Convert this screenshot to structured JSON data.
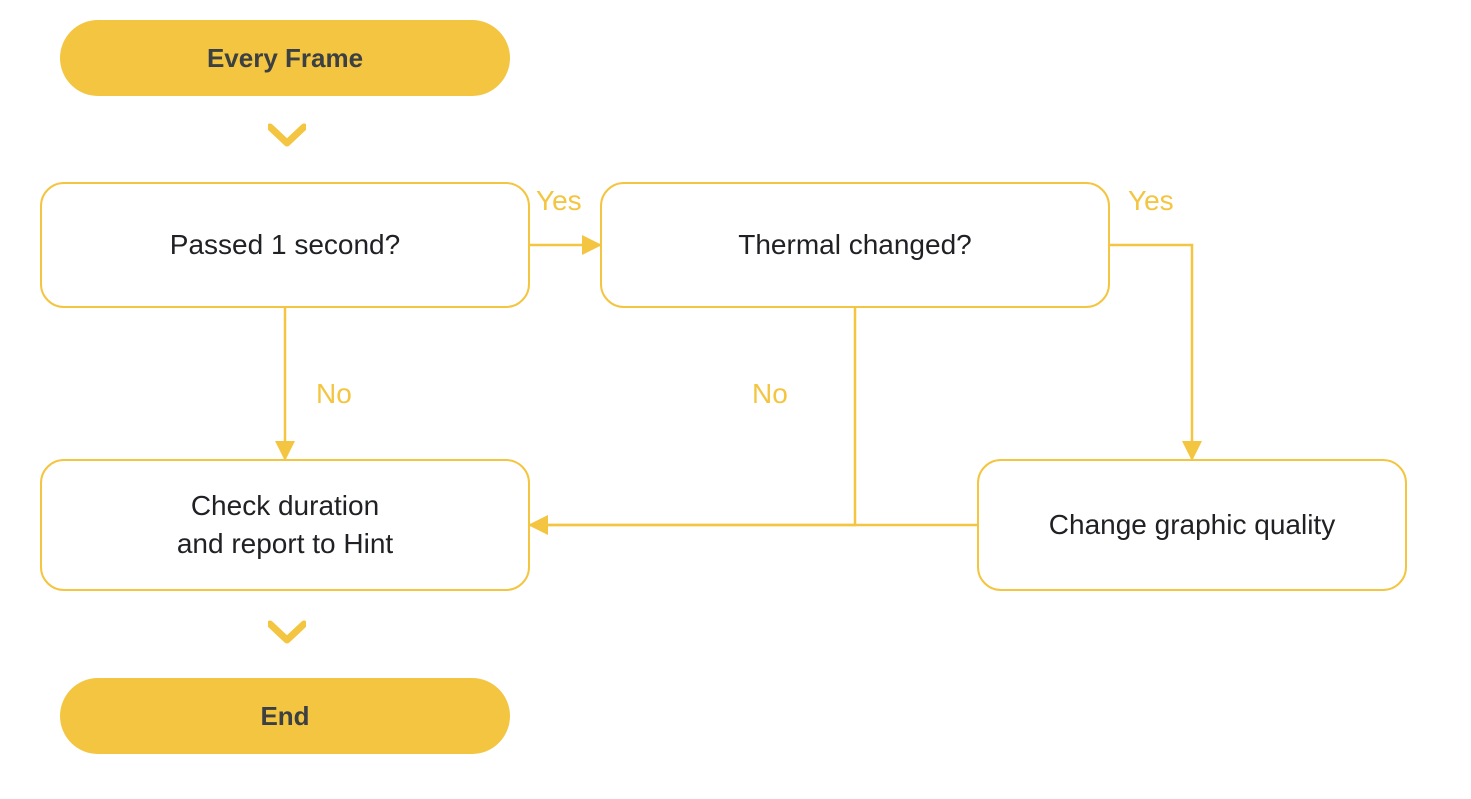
{
  "colors": {
    "accent": "#f3c540",
    "text_dark": "#3c4043",
    "text_body": "#202124",
    "background": "#ffffff"
  },
  "nodes": {
    "start": {
      "label": "Every Frame"
    },
    "decision1": {
      "label": "Passed 1 second?"
    },
    "decision2": {
      "label": "Thermal changed?"
    },
    "process1": {
      "label": "Check duration\nand report to Hint"
    },
    "process2": {
      "label": "Change graphic quality"
    },
    "end": {
      "label": "End"
    }
  },
  "edges": {
    "d1_yes": "Yes",
    "d1_no": "No",
    "d2_yes": "Yes",
    "d2_no": "No"
  },
  "chart_data": {
    "type": "flowchart",
    "nodes": [
      {
        "id": "start",
        "kind": "terminator",
        "label": "Every Frame"
      },
      {
        "id": "decision1",
        "kind": "decision",
        "label": "Passed 1 second?"
      },
      {
        "id": "decision2",
        "kind": "decision",
        "label": "Thermal changed?"
      },
      {
        "id": "process1",
        "kind": "process",
        "label": "Check duration and report to Hint"
      },
      {
        "id": "process2",
        "kind": "process",
        "label": "Change graphic quality"
      },
      {
        "id": "end",
        "kind": "terminator",
        "label": "End"
      }
    ],
    "edges": [
      {
        "from": "start",
        "to": "decision1",
        "label": ""
      },
      {
        "from": "decision1",
        "to": "decision2",
        "label": "Yes"
      },
      {
        "from": "decision1",
        "to": "process1",
        "label": "No"
      },
      {
        "from": "decision2",
        "to": "process2",
        "label": "Yes"
      },
      {
        "from": "decision2",
        "to": "process1",
        "label": "No"
      },
      {
        "from": "process2",
        "to": "process1",
        "label": ""
      },
      {
        "from": "process1",
        "to": "end",
        "label": ""
      }
    ]
  }
}
